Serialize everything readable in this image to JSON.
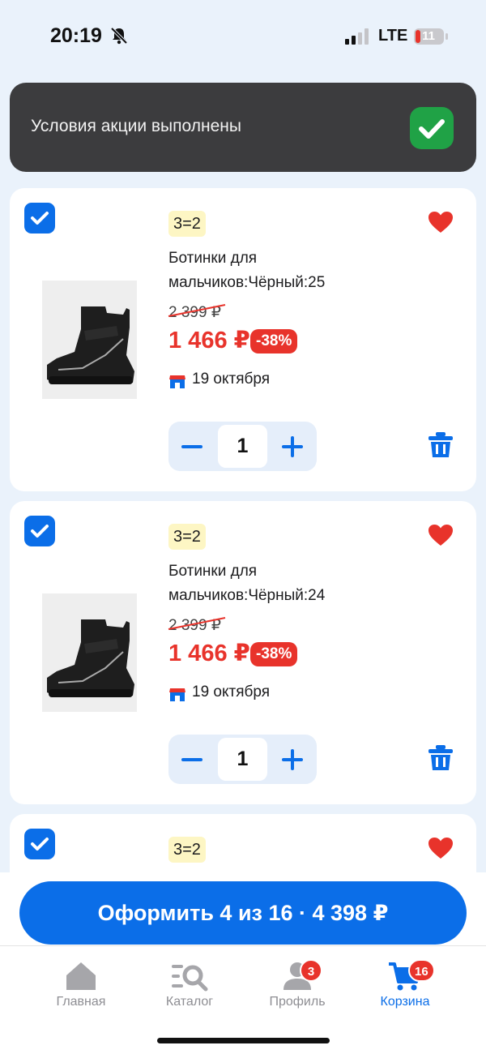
{
  "status_bar": {
    "time": "20:19",
    "network": "LTE",
    "battery": "11"
  },
  "toast": {
    "text": "Условия акции выполнены"
  },
  "cart": {
    "items": [
      {
        "promo": "3=2",
        "title": "Ботинки для мальчиков:Чёрный:25",
        "old_price": "2 399 ₽",
        "price": "1 466 ₽",
        "discount": "-38%",
        "delivery": "19 октября",
        "quantity": "1",
        "selected": true
      },
      {
        "promo": "3=2",
        "title": "Ботинки для мальчиков:Чёрный:24",
        "old_price": "2 399 ₽",
        "price": "1 466 ₽",
        "discount": "-38%",
        "delivery": "19 октября",
        "quantity": "1",
        "selected": true
      },
      {
        "promo": "3=2",
        "selected": true
      }
    ]
  },
  "checkout": {
    "label": "Оформить 4 из 16 · 4 398 ₽"
  },
  "tab_bar": {
    "tabs": [
      {
        "label": "Главная",
        "icon": "home-icon",
        "badge": ""
      },
      {
        "label": "Каталог",
        "icon": "catalog-search-icon",
        "badge": ""
      },
      {
        "label": "Профиль",
        "icon": "profile-icon",
        "badge": "3"
      },
      {
        "label": "Корзина",
        "icon": "cart-icon",
        "badge": "16",
        "active": true
      }
    ]
  },
  "colors": {
    "accent": "#0b6ee8",
    "sale": "#e8332b",
    "success": "#20a246",
    "background": "#eaf2fb"
  }
}
